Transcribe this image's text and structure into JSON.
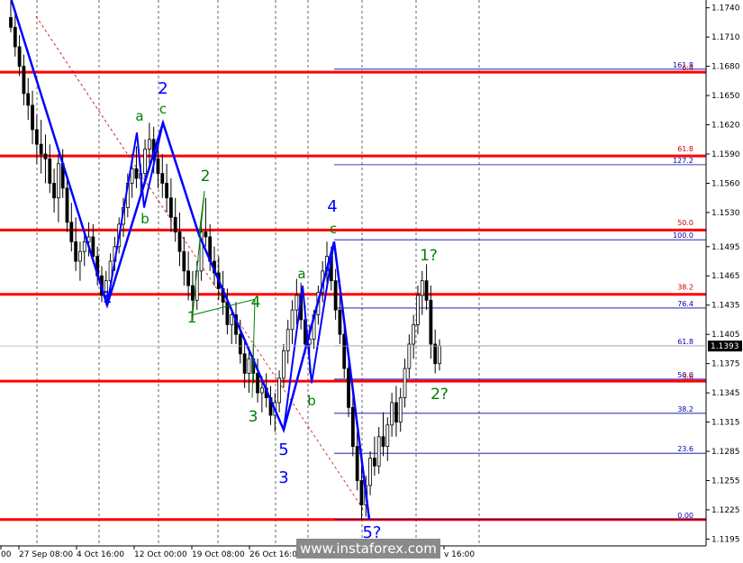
{
  "chart_data": {
    "type": "candlestick",
    "y_ticks": [
      "1.1740",
      "1.1710",
      "1.1680",
      "1.1650",
      "1.1620",
      "1.1590",
      "1.1560",
      "1.1530",
      "1.1495",
      "1.1465",
      "1.1435",
      "1.1405",
      "1.1375",
      "1.1345",
      "1.1315",
      "1.1285",
      "1.1255",
      "1.1225",
      "1.1195"
    ],
    "y_tick_values": [
      1.174,
      1.171,
      1.168,
      1.165,
      1.162,
      1.159,
      1.156,
      1.153,
      1.1495,
      1.1465,
      1.1435,
      1.1405,
      1.1375,
      1.1345,
      1.1315,
      1.1285,
      1.1255,
      1.1225,
      1.1195
    ],
    "x_ticks": [
      "00",
      "27 Sep 08:00",
      "4 Oct 16:00",
      "12 Oct 00:00",
      "19 Oct 08:00",
      "26 Oct 16:00",
      "",
      "",
      "v 16:00"
    ],
    "ylim": [
      1.1188,
      1.1748
    ],
    "current_price": "1.1393",
    "current_price_value": 1.1393,
    "horizontal_levels": [
      1.1674,
      1.1588,
      1.1512,
      1.1446,
      1.1357,
      1.1215
    ],
    "fib_right": [
      {
        "label": "161.8",
        "price": 1.1677,
        "color": "#0000aa"
      },
      {
        "label": "6.4",
        "price": 1.1674,
        "color": "#cc0000"
      },
      {
        "label": "61.8",
        "price": 1.1591,
        "color": "#cc0000"
      },
      {
        "label": "127.2",
        "price": 1.1579,
        "color": "#0000aa"
      },
      {
        "label": "50.0",
        "price": 1.1515,
        "color": "#cc0000"
      },
      {
        "label": "100.0",
        "price": 1.1502,
        "color": "#0000aa"
      },
      {
        "label": "38.2",
        "price": 1.1449,
        "color": "#cc0000"
      },
      {
        "label": "76.4",
        "price": 1.1432,
        "color": "#0000aa"
      },
      {
        "label": "61.8",
        "price": 1.1393,
        "color": "#0000aa"
      },
      {
        "label": "50.0",
        "price": 1.1359,
        "color": "#0000aa"
      },
      {
        "label": "3.6",
        "price": 1.1357,
        "color": "#cc0000"
      },
      {
        "label": "38.2",
        "price": 1.1324,
        "color": "#0000aa"
      },
      {
        "label": "23.6",
        "price": 1.1283,
        "color": "#0000aa"
      },
      {
        "label": "0.00",
        "price": 1.1215,
        "color": "#0000aa"
      }
    ],
    "waves_blue": [
      {
        "label": "2",
        "price": 1.1657
      },
      {
        "label": "1",
        "price": 1.1418
      },
      {
        "label": "4",
        "price": 1.1528
      },
      {
        "label": "5",
        "price": 1.1286
      },
      {
        "label": "3",
        "price": 1.1259
      },
      {
        "label": "5?",
        "price": 1.1201
      }
    ],
    "waves_green": [
      {
        "label": "a",
        "price": 1.1622
      },
      {
        "label": "c",
        "price": 1.1625
      },
      {
        "label": "b",
        "price": 1.1536
      },
      {
        "label": "2",
        "price": 1.1564
      },
      {
        "label": "1",
        "price": 1.1407
      },
      {
        "label": "4",
        "price": 1.1436
      },
      {
        "label": "a",
        "price": 1.1461
      },
      {
        "label": "c",
        "price": 1.151
      },
      {
        "label": "3",
        "price": 1.1311
      },
      {
        "label": "b",
        "price": 1.1335
      },
      {
        "label": "1?",
        "price": 1.1477
      },
      {
        "label": "2?",
        "price": 1.1341
      }
    ],
    "blue_wave_path": [
      1.175,
      1.1435,
      1.1622,
      1.1507,
      1.1307,
      1.15,
      1.1215
    ],
    "candles": [
      [
        1.173,
        1.175,
        1.1715,
        1.172
      ],
      [
        1.172,
        1.1735,
        1.169,
        1.17
      ],
      [
        1.17,
        1.1712,
        1.167,
        1.168
      ],
      [
        1.168,
        1.1692,
        1.164,
        1.1652
      ],
      [
        1.1652,
        1.1668,
        1.1625,
        1.164
      ],
      [
        1.164,
        1.1655,
        1.16,
        1.1615
      ],
      [
        1.1615,
        1.163,
        1.158,
        1.16
      ],
      [
        1.16,
        1.1625,
        1.157,
        1.159
      ],
      [
        1.159,
        1.161,
        1.156,
        1.1585
      ],
      [
        1.1585,
        1.16,
        1.155,
        1.156
      ],
      [
        1.156,
        1.1575,
        1.153,
        1.1545
      ],
      [
        1.1545,
        1.159,
        1.152,
        1.158
      ],
      [
        1.158,
        1.1595,
        1.1545,
        1.1555
      ],
      [
        1.1555,
        1.1568,
        1.151,
        1.152
      ],
      [
        1.152,
        1.154,
        1.149,
        1.15
      ],
      [
        1.15,
        1.1525,
        1.147,
        1.148
      ],
      [
        1.148,
        1.15,
        1.146,
        1.149
      ],
      [
        1.149,
        1.151,
        1.1475,
        1.15
      ],
      [
        1.15,
        1.152,
        1.1485,
        1.1505
      ],
      [
        1.1505,
        1.1518,
        1.148,
        1.1485
      ],
      [
        1.1485,
        1.1495,
        1.1455,
        1.1465
      ],
      [
        1.1465,
        1.1475,
        1.1438,
        1.1445
      ],
      [
        1.1445,
        1.147,
        1.1435,
        1.146
      ],
      [
        1.146,
        1.1488,
        1.145,
        1.148
      ],
      [
        1.148,
        1.1505,
        1.147,
        1.1495
      ],
      [
        1.1495,
        1.1525,
        1.1488,
        1.1518
      ],
      [
        1.1518,
        1.1545,
        1.1505,
        1.1535
      ],
      [
        1.1535,
        1.157,
        1.1525,
        1.156
      ],
      [
        1.156,
        1.159,
        1.1545,
        1.1575
      ],
      [
        1.1575,
        1.1598,
        1.1555,
        1.1565
      ],
      [
        1.1565,
        1.158,
        1.1545,
        1.157
      ],
      [
        1.157,
        1.1605,
        1.156,
        1.1595
      ],
      [
        1.1595,
        1.1622,
        1.158,
        1.1605
      ],
      [
        1.1605,
        1.1618,
        1.157,
        1.1585
      ],
      [
        1.1585,
        1.16,
        1.1555,
        1.157
      ],
      [
        1.157,
        1.159,
        1.1545,
        1.156
      ],
      [
        1.156,
        1.158,
        1.153,
        1.1545
      ],
      [
        1.1545,
        1.1565,
        1.151,
        1.1525
      ],
      [
        1.1525,
        1.1545,
        1.15,
        1.151
      ],
      [
        1.151,
        1.153,
        1.1475,
        1.149
      ],
      [
        1.149,
        1.1505,
        1.1455,
        1.147
      ],
      [
        1.147,
        1.149,
        1.144,
        1.1455
      ],
      [
        1.1455,
        1.147,
        1.142,
        1.144
      ],
      [
        1.144,
        1.148,
        1.143,
        1.147
      ],
      [
        1.147,
        1.152,
        1.146,
        1.151
      ],
      [
        1.151,
        1.1545,
        1.1495,
        1.1505
      ],
      [
        1.1505,
        1.1518,
        1.147,
        1.148
      ],
      [
        1.148,
        1.1495,
        1.1455,
        1.1468
      ],
      [
        1.1468,
        1.1485,
        1.144,
        1.1452
      ],
      [
        1.1452,
        1.147,
        1.1425,
        1.1438
      ],
      [
        1.1438,
        1.1452,
        1.1405,
        1.1415
      ],
      [
        1.1415,
        1.1432,
        1.1395,
        1.1425
      ],
      [
        1.1425,
        1.1438,
        1.1395,
        1.1405
      ],
      [
        1.1405,
        1.142,
        1.1375,
        1.1385
      ],
      [
        1.1385,
        1.14,
        1.135,
        1.1365
      ],
      [
        1.1365,
        1.1392,
        1.1345,
        1.138
      ],
      [
        1.138,
        1.1395,
        1.1355,
        1.1365
      ],
      [
        1.1365,
        1.138,
        1.1335,
        1.1345
      ],
      [
        1.1345,
        1.1362,
        1.1325,
        1.135
      ],
      [
        1.135,
        1.1365,
        1.133,
        1.134
      ],
      [
        1.134,
        1.1352,
        1.1312,
        1.1322
      ],
      [
        1.1322,
        1.1345,
        1.1305,
        1.1335
      ],
      [
        1.1335,
        1.1368,
        1.1325,
        1.136
      ],
      [
        1.136,
        1.1395,
        1.135,
        1.1388
      ],
      [
        1.1388,
        1.142,
        1.1375,
        1.141
      ],
      [
        1.141,
        1.144,
        1.1395,
        1.143
      ],
      [
        1.143,
        1.1462,
        1.1415,
        1.1445
      ],
      [
        1.1445,
        1.1458,
        1.141,
        1.142
      ],
      [
        1.142,
        1.1435,
        1.1385,
        1.1395
      ],
      [
        1.1395,
        1.1415,
        1.1365,
        1.14
      ],
      [
        1.14,
        1.143,
        1.139,
        1.1425
      ],
      [
        1.1425,
        1.1455,
        1.1415,
        1.1448
      ],
      [
        1.1448,
        1.148,
        1.1438,
        1.147
      ],
      [
        1.147,
        1.15,
        1.1455,
        1.1485
      ],
      [
        1.1485,
        1.1495,
        1.145,
        1.146
      ],
      [
        1.146,
        1.1472,
        1.142,
        1.143
      ],
      [
        1.143,
        1.1445,
        1.1395,
        1.1405
      ],
      [
        1.1405,
        1.142,
        1.136,
        1.137
      ],
      [
        1.137,
        1.1385,
        1.132,
        1.133
      ],
      [
        1.133,
        1.1345,
        1.128,
        1.129
      ],
      [
        1.129,
        1.1305,
        1.1245,
        1.1255
      ],
      [
        1.1255,
        1.127,
        1.1215,
        1.123
      ],
      [
        1.123,
        1.126,
        1.1218,
        1.125
      ],
      [
        1.125,
        1.1285,
        1.124,
        1.1278
      ],
      [
        1.1278,
        1.13,
        1.126,
        1.127
      ],
      [
        1.127,
        1.131,
        1.1262,
        1.13
      ],
      [
        1.13,
        1.1325,
        1.128,
        1.129
      ],
      [
        1.129,
        1.132,
        1.1275,
        1.1312
      ],
      [
        1.1312,
        1.1345,
        1.13,
        1.1335
      ],
      [
        1.1335,
        1.1352,
        1.13,
        1.1315
      ],
      [
        1.1315,
        1.135,
        1.1305,
        1.134
      ],
      [
        1.134,
        1.138,
        1.133,
        1.137
      ],
      [
        1.137,
        1.1405,
        1.136,
        1.1395
      ],
      [
        1.1395,
        1.1425,
        1.138,
        1.1415
      ],
      [
        1.1415,
        1.1455,
        1.1405,
        1.1445
      ],
      [
        1.1445,
        1.147,
        1.1425,
        1.146
      ],
      [
        1.146,
        1.1477,
        1.143,
        1.144
      ],
      [
        1.144,
        1.1455,
        1.138,
        1.1395
      ],
      [
        1.1395,
        1.141,
        1.1365,
        1.1375
      ],
      [
        1.1375,
        1.14,
        1.1368,
        1.1393
      ]
    ]
  },
  "watermark": "www.instaforex.com",
  "colors": {
    "level_red": "#ff0000",
    "wave_blue": "#0000ff",
    "wave_green": "#008000",
    "fib_blue": "#0000aa",
    "fib_red": "#cc0000",
    "candle": "#000000",
    "trendline": "#cc0000",
    "grid": "#000000"
  }
}
